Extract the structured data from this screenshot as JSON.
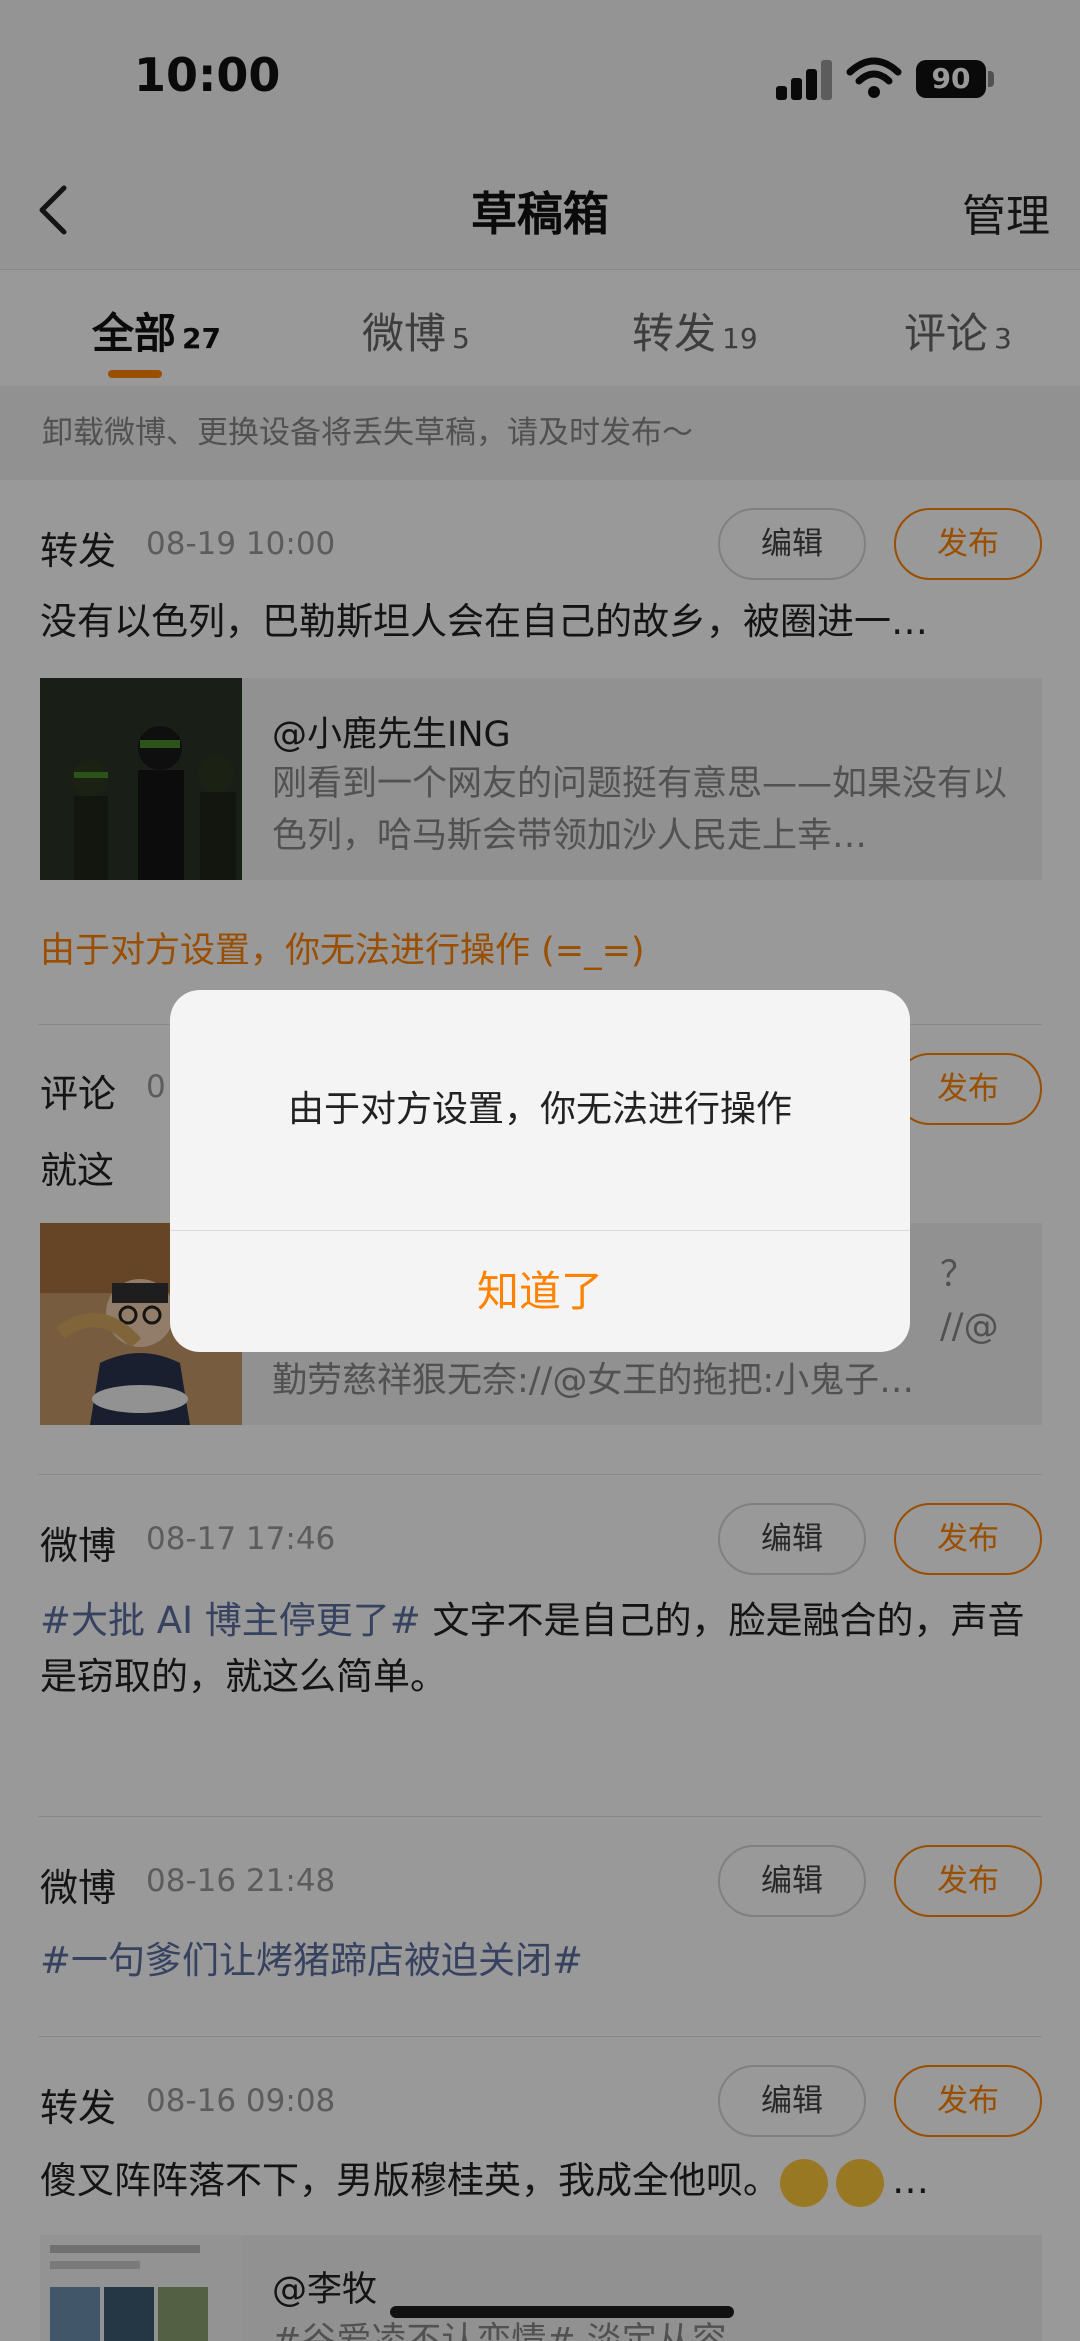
{
  "status_bar": {
    "time": "10:00",
    "battery": "90"
  },
  "nav": {
    "title": "草稿箱",
    "manage": "管理"
  },
  "tabs": [
    {
      "label": "全部",
      "count": "27",
      "active": true
    },
    {
      "label": "微博",
      "count": "5"
    },
    {
      "label": "转发",
      "count": "19"
    },
    {
      "label": "评论",
      "count": "3"
    }
  ],
  "notice": "卸载微博、更换设备将丢失草稿，请及时发布～",
  "buttons": {
    "edit": "编辑",
    "publish": "发布"
  },
  "drafts": [
    {
      "type": "转发",
      "date": "08-19 10:00",
      "text": "没有以色列，巴勒斯坦人会在自己的故乡，被圈进一…",
      "quote_author": "@小鹿先生ING",
      "quote_body": "刚看到一个网友的问题挺有意思——如果没有以色列，哈马斯会带领加沙人民走上幸…",
      "warning": "由于对方设置，你无法进行操作 (=_=)"
    },
    {
      "type": "评论",
      "date": "0",
      "text": "就这",
      "quote_tail": "？ //@",
      "quote_body": "勤劳慈祥狠无奈://@女王的拖把:小鬼子…"
    },
    {
      "type": "微博",
      "date": "08-17 17:46",
      "hashtag": "#大批 AI 博主停更了#",
      "text": " 文字不是自己的，脸是融合的，声音是窃取的，就这么简单。"
    },
    {
      "type": "微博",
      "date": "08-16 21:48",
      "hashtag": "#一句爹们让烤猪蹄店被迫关闭#"
    },
    {
      "type": "转发",
      "date": "08-16 09:08",
      "text": "傻叉阵阵落不下，男版穆桂英，我成全他呗。",
      "text_tail": "…",
      "quote_author": "@李牧",
      "quote_body": "#谷爱凌不认恋情# 淡定从容"
    }
  ],
  "dialog": {
    "message": "由于对方设置，你无法进行操作",
    "button": "知道了"
  },
  "colors": {
    "accent": "#ff8200",
    "hashtag": "#5a6fa0",
    "overlay": "rgba(0,0,0,0.40)"
  }
}
